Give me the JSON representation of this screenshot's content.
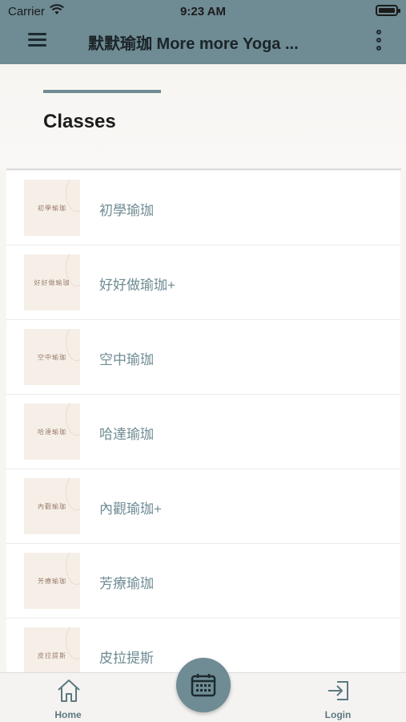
{
  "status": {
    "carrier": "Carrier",
    "time": "9:23 AM"
  },
  "appbar": {
    "title": "默默瑜珈 More more Yoga ..."
  },
  "header": {
    "title": "Classes"
  },
  "classes": [
    {
      "label": "初學瑜珈",
      "thumb": "初學瑜珈"
    },
    {
      "label": "好好做瑜珈+",
      "thumb": "好好做瑜珈"
    },
    {
      "label": "空中瑜珈",
      "thumb": "空中瑜珈"
    },
    {
      "label": "哈達瑜珈",
      "thumb": "哈達瑜珈"
    },
    {
      "label": "內觀瑜珈+",
      "thumb": "內觀瑜珈"
    },
    {
      "label": "芳療瑜珈",
      "thumb": "芳療瑜珈"
    },
    {
      "label": "皮拉提斯",
      "thumb": "皮拉提斯"
    }
  ],
  "tabs": {
    "home": "Home",
    "login": "Login"
  },
  "colors": {
    "accent": "#6f8b94",
    "label": "#6f8b94",
    "thumb_bg": "#f6efe8"
  },
  "icons": {
    "menu": "hamburger-icon",
    "more": "more-vertical-icon",
    "home": "home-icon",
    "calendar": "calendar-icon",
    "login": "login-icon"
  }
}
